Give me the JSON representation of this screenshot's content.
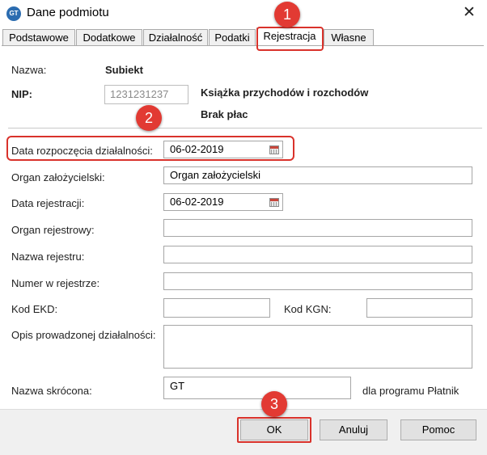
{
  "window": {
    "title": "Dane podmiotu",
    "app_icon_text": "GT",
    "close_symbol": "✕"
  },
  "tabs": [
    {
      "label": "Podstawowe"
    },
    {
      "label": "Dodatkowe"
    },
    {
      "label": "Działalność"
    },
    {
      "label": "Podatki"
    },
    {
      "label": "Rejestracja",
      "active": true
    },
    {
      "label": "Własne"
    }
  ],
  "header": {
    "name_label": "Nazwa:",
    "name_value": "Subiekt",
    "nip_label": "NIP:",
    "nip_value": "1231231237",
    "book_type": "Książka przychodów i rozchodów",
    "payroll": "Brak płac"
  },
  "form": {
    "start_date_label": "Data rozpoczęcia działalności:",
    "start_date_value": "06-02-2019",
    "founding_body_label": "Organ założycielski:",
    "founding_body_value": "Organ założycielski",
    "registration_date_label": "Data rejestracji:",
    "registration_date_value": "06-02-2019",
    "registry_body_label": "Organ rejestrowy:",
    "registry_body_value": "",
    "registry_name_label": "Nazwa rejestru:",
    "registry_name_value": "",
    "registry_number_label": "Numer w rejestrze:",
    "registry_number_value": "",
    "ekd_label": "Kod EKD:",
    "ekd_value": "",
    "kgn_label": "Kod KGN:",
    "kgn_value": "",
    "activity_description_label": "Opis prowadzonej działalności:",
    "activity_description_value": "",
    "short_name_label": "Nazwa skrócona:",
    "short_name_value": "GT",
    "short_name_note": "dla programu Płatnik"
  },
  "buttons": {
    "ok": "OK",
    "cancel": "Anuluj",
    "help": "Pomoc"
  },
  "annotations": [
    {
      "number": "1"
    },
    {
      "number": "2"
    },
    {
      "number": "3"
    }
  ],
  "colors": {
    "highlight": "#d9322b",
    "badge": "#e23a33",
    "icon_blue": "#2b6cb0"
  }
}
